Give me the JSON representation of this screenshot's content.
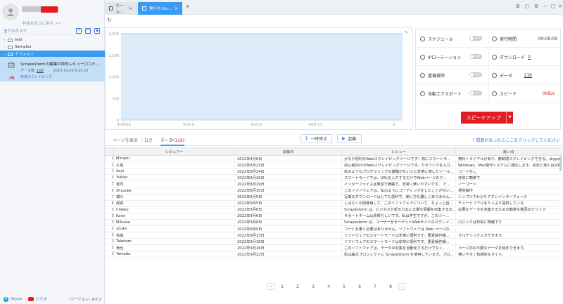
{
  "sidebar": {
    "plan_link": "料金を払うに戻す >>",
    "tasks_title": "全てのタスク",
    "tree": [
      {
        "label": "test"
      },
      {
        "label": "Samples"
      },
      {
        "label": "デフォルト"
      }
    ],
    "task": {
      "name": "ScrapeStormの異業の評判レビュー口コミ...",
      "data_label": "データ数",
      "data_count": "116",
      "date": "2023-10-26 6:25:23",
      "mode": "高速スクレイピング"
    },
    "footer": {
      "skype": "Skype",
      "video": "ビデオ",
      "version": "バージョン: 4.0.1"
    }
  },
  "topbar": {
    "tabs": [
      {
        "label": "ホーム..."
      },
      {
        "label": "実行中-Scr..."
      }
    ]
  },
  "chart_data": {
    "type": "area",
    "x_ticks": [
      "9/24/38",
      "9/25:0",
      "9/25:8",
      "9/25:13",
      "0"
    ],
    "y_ticks": [
      "2,000",
      "1,500",
      "1,000",
      "500",
      "0"
    ],
    "ylim": [
      0,
      2000
    ],
    "series": [
      {
        "values": [
          2000,
          2000,
          2000,
          2000,
          2000
        ]
      }
    ],
    "colors": {
      "fill": "#dcebfa",
      "line": "#9dc8f0"
    }
  },
  "status": {
    "schedule": {
      "label": "スケジュール",
      "toggle": "OFF"
    },
    "runtime": {
      "label": "実行時間",
      "value": "00:00:00"
    },
    "ip_rotation": {
      "label": "IPローテーション",
      "toggle": "OFF"
    },
    "download": {
      "label": "ダウンロード",
      "value": "0"
    },
    "dedup": {
      "label": "重複排除",
      "toggle": "OFF"
    },
    "data": {
      "label": "データ",
      "value": "116"
    },
    "auto_export": {
      "label": "自動エクスポート",
      "toggle": "OFF"
    },
    "speed": {
      "label": "スピード",
      "value": "0KB/s"
    },
    "speedup_button": "スピードアップ"
  },
  "data_tabs": {
    "page": "ページを表示",
    "log": "ログ",
    "data": "データ",
    "data_count": "(116)",
    "pause": "一時停止",
    "start": "起動",
    "help": "問題があったらここをクリックしてください"
  },
  "table": {
    "headers": [
      "",
      "レビュアー",
      "投稿日",
      "レビュー",
      "良い点"
    ],
    "rows": [
      [
        "1",
        "Minami",
        "2022年4月6日",
        "かなり便利なWebスクレイピングツールです！特にスマートモ...",
        "無料トライアルがあり、無制限スクレイピングできる。skypeで..."
      ],
      [
        "2",
        "久俊",
        "2022年8月23日",
        "初心者向けのWebスクレイピングツールです。カセツシクを入力...",
        "Windows、Mac版作システムに適応します。会社と家2 台のPC..."
      ],
      [
        "3",
        "Aoyi",
        "2022年8月24日",
        "私のようなプログラミングの基礎がない人に非常に適したツール...",
        "コードなし"
      ],
      [
        "4",
        "Yukiko",
        "2022年8月26日",
        "スマートモードでは、URLを入力するだけでWebページのデ...",
        "非常に簡単で"
      ],
      [
        "5",
        "桂司",
        "2022年8月29日",
        "インターフェイスは簡潔で綺麗で、非常に使いやすいです。 ア...",
        "ノーコード"
      ],
      [
        "6",
        "Shusuke",
        "2022年8月30日",
        "このソフトウェアは、私のようにコーディングをしたことがない...",
        "視覚操作"
      ],
      [
        "7",
        "博川",
        "2022年9月5日",
        "写真のダウンロードはとても便利で、使い方も難しくありません...",
        "シンプルでわかりやすいインターフェース"
      ],
      [
        "8",
        "成真",
        "2022年9月5日",
        "しばらくの間使用して、このソフトウェアについて、ちょっと話...",
        "チュートリアルをたっぷり提供している"
      ],
      [
        "9",
        "Chieko",
        "2022年9月6日",
        "Scrapestorm は、ビジネス分析のために大量な情報を収集するの...",
        "必要なデータを収集するための簡単な数回のクリック"
      ],
      [
        "10",
        "Karin",
        "2022年9月6日",
        "サポートチームは素晴らしいです。私は学生ですが、このツー...",
        ""
      ],
      [
        "11",
        "Mitsusa",
        "2022年9月8日",
        "Scrapestorm は、ユーザーがターゲットWebサイトのスクレイ...",
        "ロジックは非常に明確です"
      ],
      [
        "12",
        "youko",
        "2022年9月9日",
        "コードを書く必要はありません。ソフトウェアは Web ページの...",
        ""
      ],
      [
        "13",
        "佑哉",
        "2022年9月13日",
        "ソフトウェアのスマートモードは非常に便利です。要素操作報...",
        "マルチリンク入力できます。"
      ],
      [
        "14",
        "Takeforo",
        "2022年9月16日",
        "ソフトウェアのスマートモードは非常に便利です。要素操作報...",
        ""
      ],
      [
        "15",
        "竜也",
        "2022年9月16日",
        "このソフトウェアは、データの収集を自動化するだけでなく、...",
        "ページ内の不要なデータを除外できます。"
      ],
      [
        "16",
        "Yamada",
        "2022年9月22日",
        "私は論文プロジェクトに ScrapeStorm を使用しています。プロ...",
        "使いやすく包括的なガイド。"
      ]
    ]
  },
  "pager": {
    "pages": [
      "1",
      "2",
      "3",
      "4",
      "5",
      "6",
      "7",
      "8"
    ]
  }
}
